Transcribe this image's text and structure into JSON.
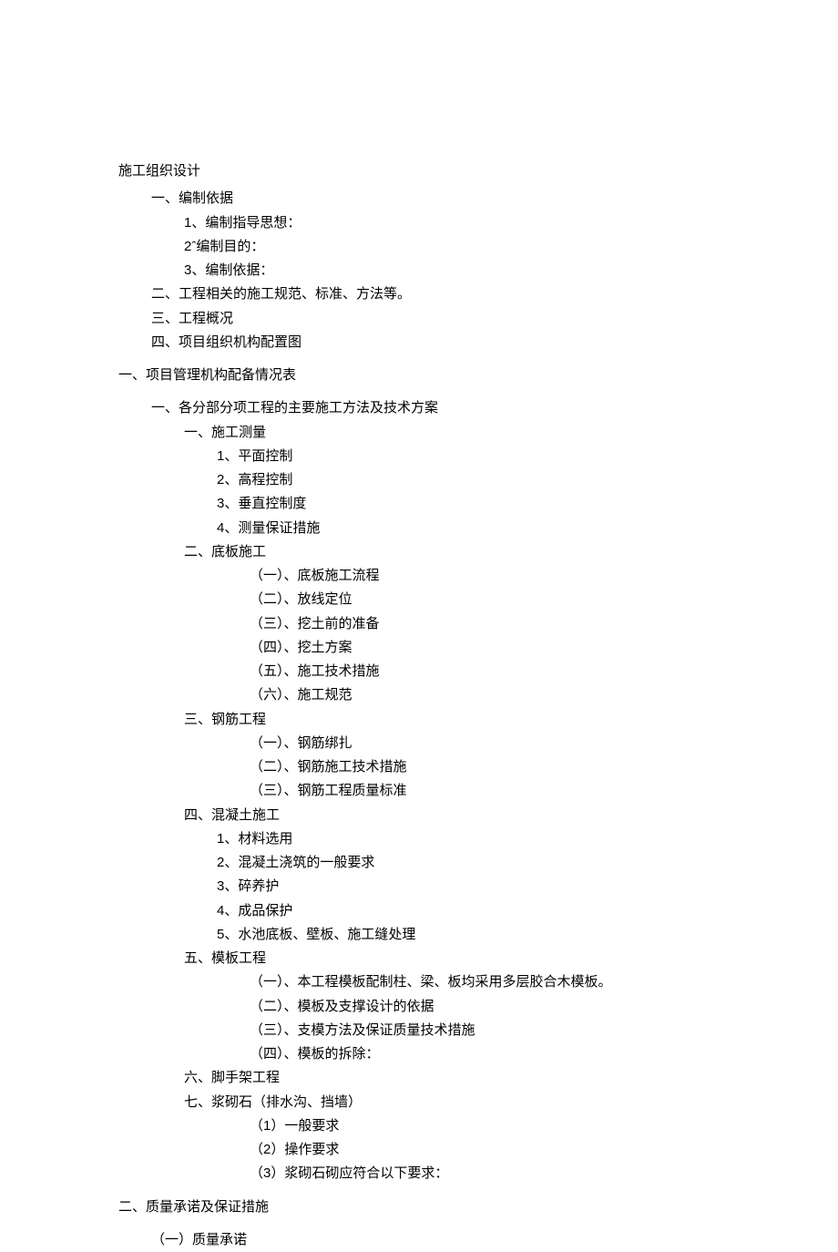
{
  "title": "施工组织设计",
  "section1": {
    "item1": "一、编制依据",
    "subitems": [
      "1、编制指导思想：",
      "2ˆ编制目的：",
      "3、编制依据："
    ],
    "item2": "二、工程相关的施工规范、标准、方法等。",
    "item3": "三、工程概况",
    "item4": "四、项目组织机构配置图"
  },
  "heading1": "一、项目管理机构配备情况表",
  "section2": {
    "item1": "一、各分部分项工程的主要施工方法及技术方案",
    "sub1": {
      "header": "一、施工测量",
      "items": [
        "1、平面控制",
        "2、高程控制",
        "3、垂直控制度",
        "4、测量保证措施"
      ]
    },
    "sub2": {
      "header": "二、底板施工",
      "items": [
        "（一）、底板施工流程",
        "（二）、放线定位",
        "（三）、挖土前的准备",
        "（四）、挖土方案",
        "（五）、施工技术措施",
        "（六）、施工规范"
      ]
    },
    "sub3": {
      "header": "三、钢筋工程",
      "items": [
        "（一）、钢筋绑扎",
        "（二）、钢筋施工技术措施",
        "（三）、钢筋工程质量标准"
      ]
    },
    "sub4": {
      "header": "四、混凝土施工",
      "items": [
        "1、材料选用",
        "2、混凝土浇筑的一般要求",
        "3、碎养护",
        "4、成品保护",
        "5、水池底板、壁板、施工缝处理"
      ]
    },
    "sub5": {
      "header": "五、模板工程",
      "items": [
        "（一）、本工程模板配制柱、梁、板均采用多层胶合木模板。",
        "（二）、模板及支撑设计的依据",
        "（三）、支模方法及保证质量技术措施",
        "（四）、模板的拆除："
      ]
    },
    "sub6": {
      "header": "六、脚手架工程"
    },
    "sub7": {
      "header": "七、浆砌石（排水沟、挡墙）",
      "items": [
        "（1）一般要求",
        "（2）操作要求",
        "（3）浆砌石砌应符合以下要求："
      ]
    }
  },
  "heading2": "二、质量承诺及保证措施",
  "section3": {
    "item1": "（一）质量承诺"
  }
}
